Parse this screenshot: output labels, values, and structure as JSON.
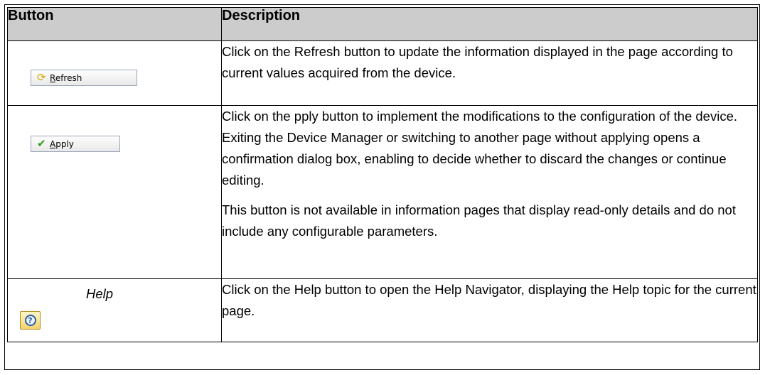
{
  "table": {
    "header_button": "Button",
    "header_description": "Description"
  },
  "rows": [
    {
      "button_label_first": "R",
      "button_label_rest": "efresh",
      "icon": "refresh-icon",
      "paragraphs": [
        "Click on the Refresh button to update the information displayed in the page according to current values acquired from the device."
      ]
    },
    {
      "button_label_first": "A",
      "button_label_rest": "pply",
      "icon": "checkmark-icon",
      "paragraphs": [
        "Click on the pply button to implement the modifications to the configuration of the device. Exiting the Device Manager or switching to another page without applying opens a confirmation dialog box, enabling to decide whether to discard the changes or continue editing.",
        "This button is not available in information pages that display read-only details and do not include any configurable parameters."
      ]
    },
    {
      "button_label": "Help",
      "icon": "help-icon",
      "icon_glyph": "?",
      "paragraphs": [
        "Click on the Help button to open the Help Navigator, displaying the Help topic for the current page."
      ]
    }
  ],
  "colors": {
    "header_background": "#cccccc",
    "border": "#000000"
  }
}
